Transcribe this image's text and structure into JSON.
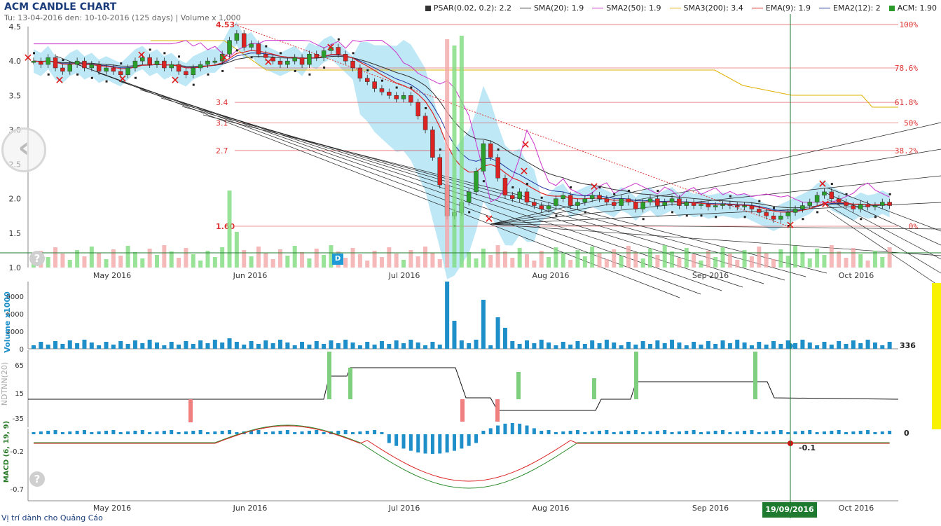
{
  "header": {
    "title": "ACM CANDLE CHART",
    "subtitle": "Tu: 13-04-2016 den: 10-10-2016 (125 days) | Volume x 1,000"
  },
  "legend": [
    {
      "label": "PSAR(0.02, 0.2): 2.2",
      "color": "#333333",
      "kind": "square"
    },
    {
      "label": "SMA(20): 1.9",
      "color": "#333333",
      "kind": "line"
    },
    {
      "label": "SMA2(50): 1.9",
      "color": "#cc33cc",
      "kind": "line"
    },
    {
      "label": "SMA3(200): 3.4",
      "color": "#e0b000",
      "kind": "line"
    },
    {
      "label": "EMA(9): 1.9",
      "color": "#dd2222",
      "kind": "line"
    },
    {
      "label": "EMA2(12): 2",
      "color": "#223399",
      "kind": "line"
    },
    {
      "label": "ACM: 1.90",
      "color": "#2a9a2a",
      "kind": "square"
    }
  ],
  "footer": {
    "ad_text": "Vị trí dành cho Quảng Cáo",
    "date_label": "19/09/2016",
    "d_marker": "D",
    "help": "?",
    "nav_left": "‹"
  },
  "colors": {
    "up": "#2aa02a",
    "down": "#dd2222",
    "volume": "#1e8fc8",
    "cloud": "#b8e6f6",
    "fib": "#dd3333",
    "crosshair": "#1e7a2e"
  },
  "chart_data": [
    {
      "type": "candlestick",
      "title": "ACM CANDLE CHART",
      "ylim": [
        1.0,
        4.5
      ],
      "yticks": [
        "1.0",
        "1.5",
        "2.0",
        "2.5",
        "3.0",
        "3.5",
        "4.0",
        "4.5"
      ],
      "xticks": [
        "May 2016",
        "Jun 2016",
        "Jul 2016",
        "Aug 2016",
        "Sep 2016",
        "Oct 2016"
      ],
      "fib_levels": [
        {
          "price": 4.53,
          "pct": "100%",
          "label": "4.53"
        },
        {
          "price": 3.9,
          "pct": "78.6%",
          "label": ""
        },
        {
          "price": 3.4,
          "pct": "61.8%",
          "label": "3.4"
        },
        {
          "price": 3.1,
          "pct": "50%",
          "label": "3.1"
        },
        {
          "price": 2.7,
          "pct": "38.2%",
          "label": "2.7"
        },
        {
          "price": 1.6,
          "pct": "0%",
          "label": "1.60"
        }
      ],
      "closes": [
        4.0,
        3.95,
        4.05,
        3.9,
        3.85,
        3.95,
        4.0,
        3.9,
        3.95,
        3.85,
        3.9,
        3.85,
        3.8,
        3.9,
        4.0,
        4.05,
        3.95,
        4.0,
        3.9,
        3.95,
        3.85,
        3.8,
        3.9,
        3.95,
        4.0,
        4.0,
        4.1,
        4.3,
        4.4,
        4.2,
        4.25,
        4.1,
        4.05,
        4.0,
        3.95,
        4.0,
        4.05,
        3.95,
        4.1,
        4.05,
        4.15,
        4.2,
        4.1,
        4.0,
        3.9,
        3.75,
        3.7,
        3.6,
        3.55,
        3.5,
        3.45,
        3.5,
        3.4,
        3.2,
        3.0,
        2.6,
        2.2,
        1.75,
        1.8,
        1.95,
        2.1,
        2.4,
        2.8,
        2.6,
        2.3,
        2.05,
        2.0,
        2.1,
        1.95,
        1.9,
        1.85,
        1.9,
        2.0,
        2.05,
        1.9,
        1.95,
        2.0,
        2.05,
        2.0,
        1.95,
        1.9,
        2.0,
        1.95,
        1.85,
        1.95,
        2.0,
        1.9,
        1.95,
        2.0,
        1.9,
        1.95,
        1.9,
        1.92,
        1.88,
        1.9,
        1.92,
        1.9,
        1.88,
        1.9,
        1.85,
        1.8,
        1.75,
        1.7,
        1.75,
        1.8,
        1.85,
        1.9,
        1.95,
        2.05,
        2.1,
        2.0,
        1.95,
        1.9,
        1.85,
        1.92,
        1.88,
        1.9,
        1.95,
        1.9
      ]
    },
    {
      "type": "bar",
      "title": "Volume x1000",
      "ylabel": "Volume x1000",
      "yticks": [
        "0",
        "3000",
        "6000",
        "9000"
      ],
      "last_value_label": "336"
    },
    {
      "type": "bar",
      "title": "NDTNN(20)",
      "ylabel": "NDTNN(20)",
      "yticks": [
        "65",
        "15",
        "-35"
      ]
    },
    {
      "type": "line",
      "title": "MACD (6, 19, 9)",
      "ylabel": "MACD (6, 19, 9)",
      "yticks": [
        "-0.2",
        "-0.7"
      ],
      "zero_label": "0",
      "marker_label": "-0.1"
    }
  ]
}
